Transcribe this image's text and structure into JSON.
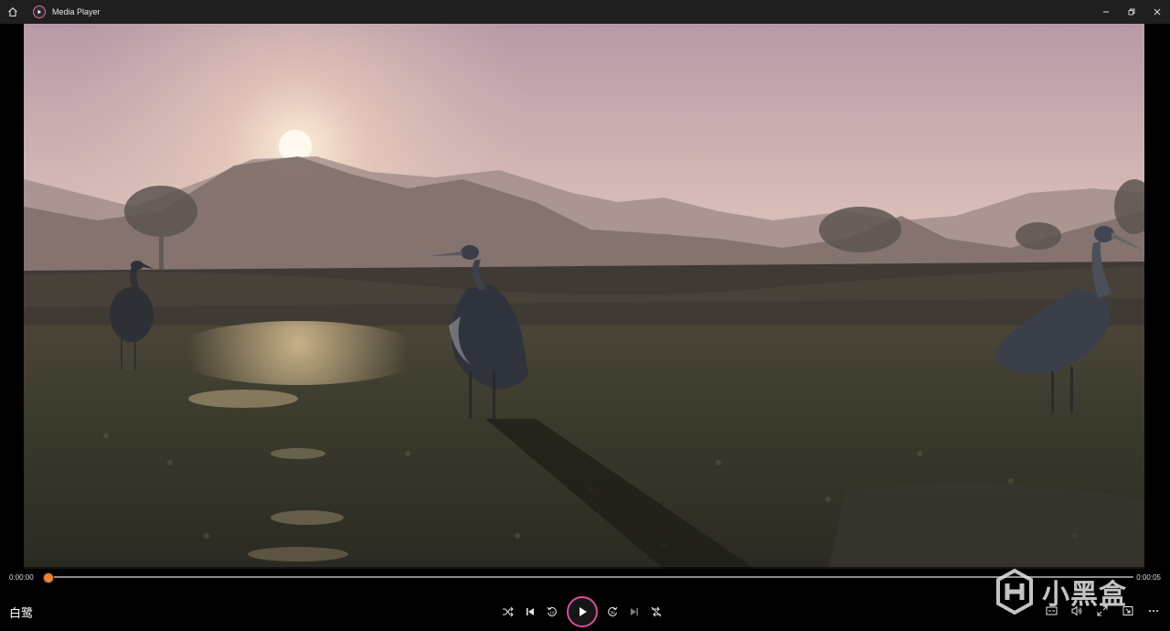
{
  "window": {
    "title": "Media Player",
    "controls": [
      "minimize-icon",
      "restore-icon",
      "close-icon"
    ]
  },
  "player": {
    "current_time": "0:00:00",
    "duration": "0:00:05",
    "progress": 0.0,
    "media_title": "白鹭",
    "accent_color": "#d64fa0",
    "seek_color": "#f07a3a"
  },
  "transport": [
    "shuffle-icon",
    "previous-icon",
    "rewind-10-icon",
    "play-icon",
    "forward-30-icon",
    "next-icon",
    "repeat-icon"
  ],
  "right_tools": [
    "caption-icon",
    "volume-icon",
    "fullscreen-icon",
    "mini-player-icon",
    "more-icon"
  ],
  "watermark": {
    "text": "小黑盒"
  }
}
